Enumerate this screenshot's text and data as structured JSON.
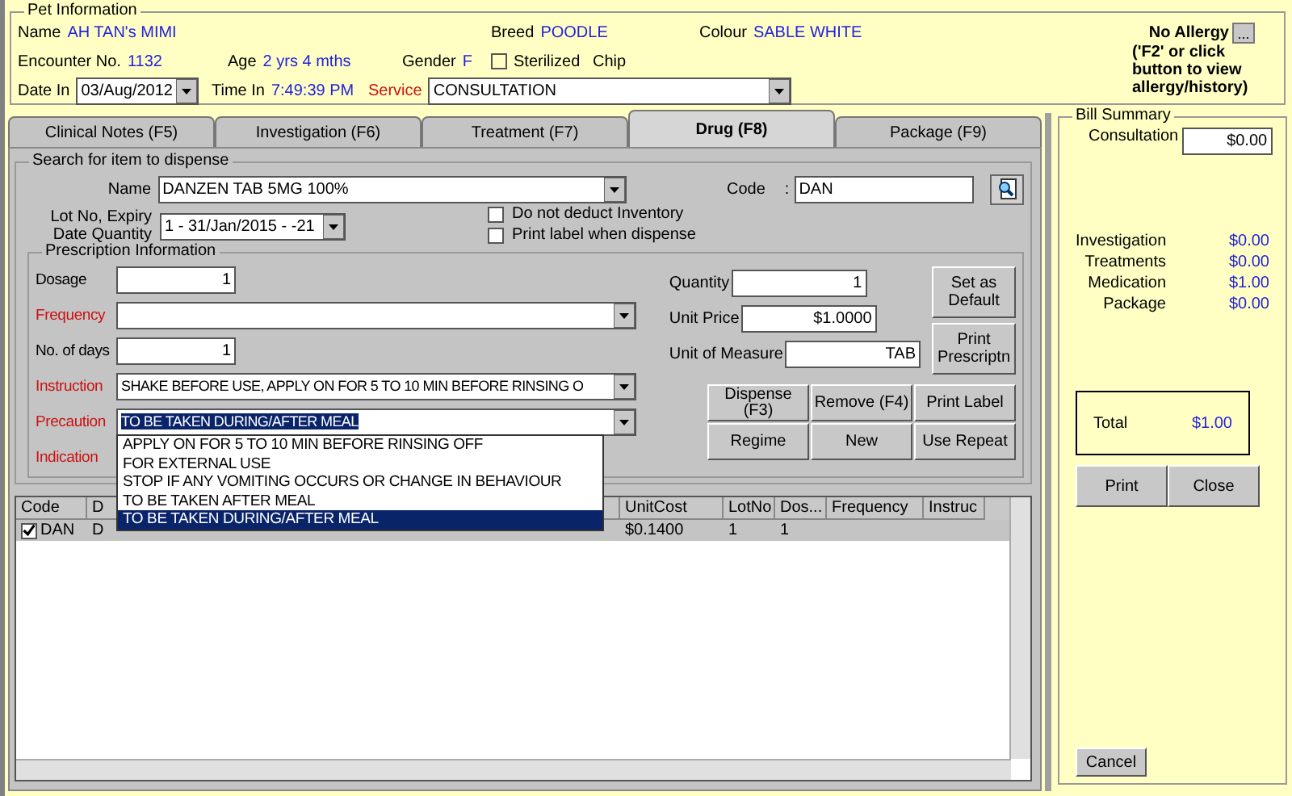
{
  "pet_info": {
    "title": "Pet Information",
    "name": {
      "label": "Name",
      "value": "AH TAN's MIMI"
    },
    "breed": {
      "label": "Breed",
      "value": "POODLE"
    },
    "colour": {
      "label": "Colour",
      "value": "SABLE WHITE"
    },
    "encounter": {
      "label": "Encounter No.",
      "value": "1132"
    },
    "age": {
      "label": "Age",
      "value": "2 yrs 4 mths"
    },
    "gender": {
      "label": "Gender",
      "value": "F"
    },
    "sterilized": {
      "label": "Sterilized",
      "checked": false
    },
    "chip": {
      "label": "Chip"
    },
    "date_in": {
      "label": "Date In",
      "value": "03/Aug/2012"
    },
    "time_in": {
      "label": "Time In",
      "value": "7:49:39 PM"
    },
    "service": {
      "label": "Service",
      "value": "CONSULTATION"
    },
    "allergy": {
      "label": "No Allergy",
      "button": "...",
      "hint": "('F2' or click button to view allergy/history)"
    }
  },
  "tabs": [
    {
      "label": "Clinical Notes (F5)",
      "selected": false
    },
    {
      "label": "Investigation (F6)",
      "selected": false
    },
    {
      "label": "Treatment (F7)",
      "selected": false
    },
    {
      "label": "Drug (F8)",
      "selected": true
    },
    {
      "label": "Package (F9)",
      "selected": false
    }
  ],
  "search": {
    "title": "Search for item to dispense",
    "name": {
      "label": "Name",
      "value": "DANZEN TAB 5MG 100%"
    },
    "code": {
      "label": "Code",
      "separator": ":",
      "value": "DAN"
    },
    "lot": {
      "label": "Lot No, Expiry Date Quantity",
      "value": "1 - 31/Jan/2015 - -21"
    },
    "options": [
      {
        "label": "Do not deduct Inventory",
        "checked": false
      },
      {
        "label": "Print label when dispense",
        "checked": false
      }
    ]
  },
  "prescription": {
    "title": "Prescription Information",
    "fields": [
      {
        "label": "Dosage",
        "kind": "number",
        "value": "1",
        "required": false
      },
      {
        "label": "Frequency",
        "kind": "combo",
        "required": true
      },
      {
        "label": "No. of days",
        "kind": "number",
        "value": "1",
        "required": false
      },
      {
        "label": "Instruction",
        "kind": "combo",
        "value": "SHAKE BEFORE USE, APPLY ON FOR 5 TO 10 MIN BEFORE RINSING O",
        "required": true
      },
      {
        "label": "Precaution",
        "kind": "combo",
        "value": "TO BE TAKEN DURING/AFTER MEAL",
        "required": true,
        "highlighted": true
      },
      {
        "label": "Indication",
        "kind": "hidden",
        "required": true
      }
    ],
    "right_fields": [
      {
        "label": "Quantity",
        "value": "1"
      },
      {
        "label": "Unit Price",
        "value": "$1.0000"
      },
      {
        "label": "Unit of Measure",
        "value": "TAB"
      }
    ],
    "side_buttons": [
      "Set as Default",
      "Print Prescriptn"
    ],
    "actions": [
      "Dispense (F3)",
      "Remove (F4)",
      "Print Label",
      "Regime",
      "New",
      "Use Repeat"
    ],
    "dropdown": [
      {
        "label": "APPLY ON FOR 5 TO 10 MIN BEFORE RINSING OFF",
        "selected": false
      },
      {
        "label": "FOR EXTERNAL USE",
        "selected": false
      },
      {
        "label": "STOP IF ANY VOMITING OCCURS OR CHANGE IN BEHAVIOUR",
        "selected": false
      },
      {
        "label": "TO BE TAKEN AFTER MEAL",
        "selected": false
      },
      {
        "label": "TO BE TAKEN DURING/AFTER MEAL",
        "selected": true
      }
    ]
  },
  "table": {
    "columns": [
      "Code",
      "D",
      "UnitCost",
      "LotNo",
      "Dos...",
      "Frequency",
      "Instruc"
    ],
    "rows": [
      {
        "checked": true,
        "selected": true,
        "cells": [
          "DAN",
          "D",
          "$0.1400",
          "1",
          "1",
          "",
          ""
        ]
      }
    ]
  },
  "bill": {
    "title": "Bill Summary",
    "consultation": {
      "label": "Consultation",
      "value": "$0.00"
    },
    "items": [
      {
        "label": "Investigation",
        "value": "$0.00"
      },
      {
        "label": "Treatments",
        "value": "$0.00"
      },
      {
        "label": "Medication",
        "value": "$1.00"
      },
      {
        "label": "Package",
        "value": "$0.00"
      }
    ],
    "total": {
      "label": "Total",
      "value": "$1.00"
    },
    "buttons": [
      "Print",
      "Close"
    ],
    "cancel": "Cancel"
  }
}
